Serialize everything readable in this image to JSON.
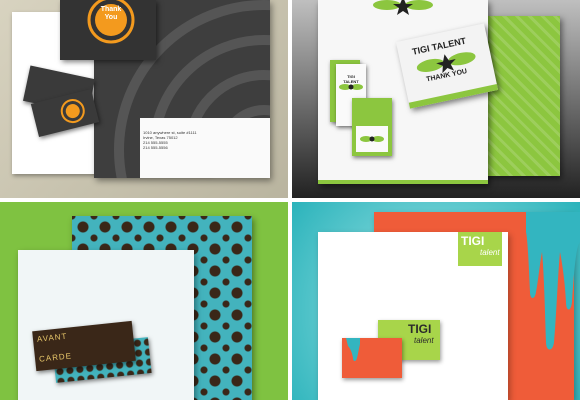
{
  "panels": [
    {
      "id": "q1",
      "thank_you_line1": "Thank",
      "thank_you_line2": "You",
      "address_lines": [
        "1010 anywhere st, suite #1111",
        "Irvine, Texas 75012",
        "214 555-5555",
        "214 555-5556"
      ],
      "colors": {
        "orange": "#f39a1e",
        "dark": "#3e3e3e",
        "paper": "#ffffff"
      }
    },
    {
      "id": "q2",
      "brand": "TIGI TALENT",
      "thank_you": "THANK YOU",
      "colors": {
        "green": "#8cc63f",
        "paper": "#f7f7f7"
      }
    },
    {
      "id": "q3",
      "card_line1": "AVANT",
      "card_line2": "CARDE",
      "colors": {
        "teal": "#43b3bd",
        "brown": "#3a2718",
        "paper": "#f1f6f7"
      }
    },
    {
      "id": "q4",
      "logo_word1": "TIGI",
      "logo_word2": "talent",
      "colors": {
        "coral": "#ef5c39",
        "lime": "#a8d54a",
        "drip": "#33b5c0"
      }
    }
  ]
}
